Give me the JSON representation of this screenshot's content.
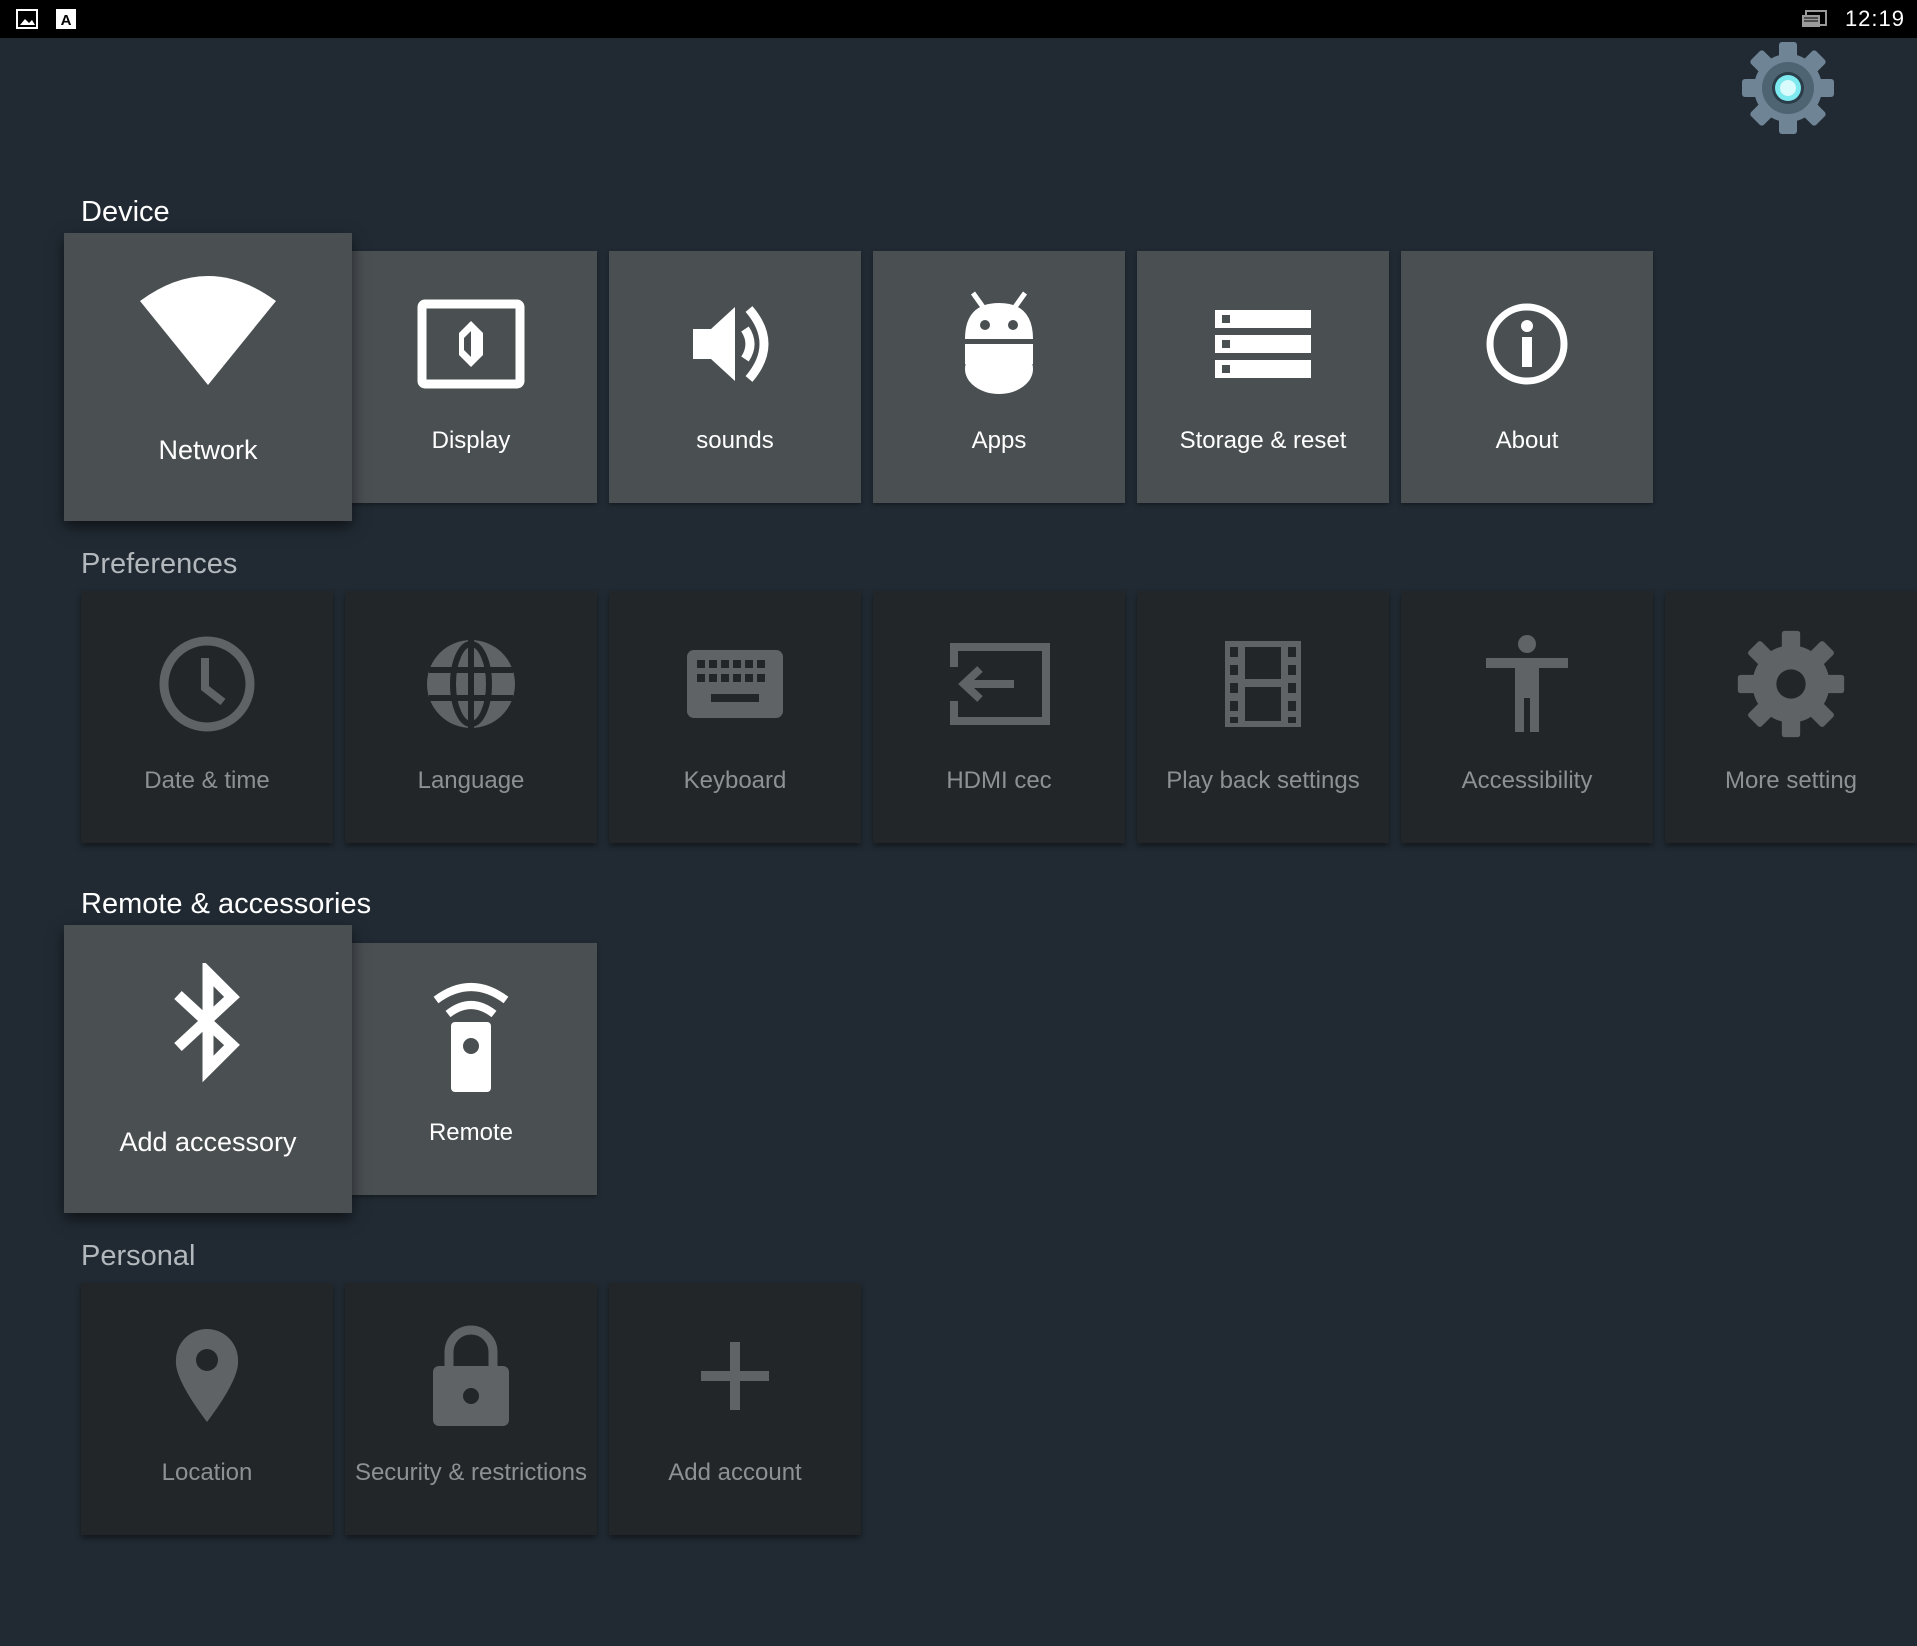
{
  "status_bar": {
    "left_icons": [
      "image-icon",
      "a-letter-icon"
    ],
    "right_icon": "cast-icon",
    "clock": "12:19"
  },
  "app_icon": "settings-gear-logo",
  "sections": {
    "device": {
      "title": "Device",
      "items": [
        {
          "label": "Network",
          "icon": "wifi-icon"
        },
        {
          "label": "Display",
          "icon": "display-icon"
        },
        {
          "label": "sounds",
          "icon": "volume-icon"
        },
        {
          "label": "Apps",
          "icon": "android-icon"
        },
        {
          "label": "Storage & reset",
          "icon": "storage-icon"
        },
        {
          "label": "About",
          "icon": "info-icon"
        }
      ]
    },
    "preferences": {
      "title": "Preferences",
      "items": [
        {
          "label": "Date & time",
          "icon": "clock-icon"
        },
        {
          "label": "Language",
          "icon": "globe-icon"
        },
        {
          "label": "Keyboard",
          "icon": "keyboard-icon"
        },
        {
          "label": "HDMI cec",
          "icon": "input-icon"
        },
        {
          "label": "Play back settings",
          "icon": "film-icon"
        },
        {
          "label": "Accessibility",
          "icon": "accessibility-icon"
        },
        {
          "label": "More setting",
          "icon": "gear-icon"
        }
      ]
    },
    "remote": {
      "title": "Remote & accessories",
      "items": [
        {
          "label": "Add accessory",
          "icon": "bluetooth-icon"
        },
        {
          "label": "Remote",
          "icon": "remote-icon"
        }
      ]
    },
    "personal": {
      "title": "Personal",
      "items": [
        {
          "label": "Location",
          "icon": "location-pin-icon"
        },
        {
          "label": "Security & restrictions",
          "icon": "lock-icon"
        },
        {
          "label": "Add account",
          "icon": "plus-icon"
        }
      ]
    }
  },
  "colors": {
    "background": "#212a33",
    "tile_active": "#4a4f52",
    "tile_inactive": "#232628",
    "text_active": "#ffffff",
    "text_inactive": "#8d9194",
    "logo_accent": "#7fe9f0"
  }
}
